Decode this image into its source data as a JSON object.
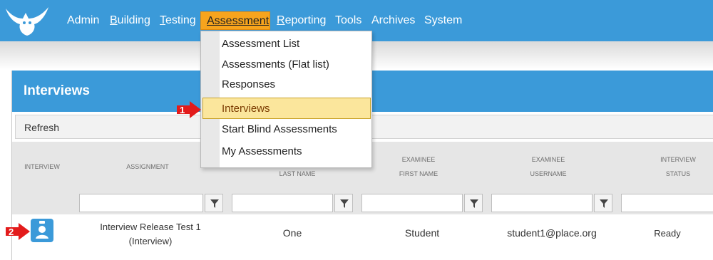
{
  "nav": {
    "admin": "Admin",
    "building_first": "B",
    "building_rest": "uilding",
    "testing_first": "T",
    "testing_rest": "esting",
    "assessment": "Assessment",
    "reporting_first": "R",
    "reporting_rest": "eporting",
    "tools": "Tools",
    "archives": "Archives",
    "system": "System"
  },
  "menu": {
    "items": [
      "Assessment List",
      "Assessments (Flat list)",
      "Responses",
      "Interviews",
      "Start Blind Assessments",
      "My Assessments"
    ],
    "highlighted": "Interviews"
  },
  "panel": {
    "title": "Interviews",
    "refresh": "Refresh"
  },
  "grid": {
    "headers": {
      "interview": "INTERVIEW",
      "assignment": "ASSIGNMENT",
      "last_name": "LAST NAME",
      "examinee1": "EXAMINEE",
      "first_name": "FIRST NAME",
      "examinee2": "EXAMINEE",
      "username": "USERNAME",
      "interview2": "INTERVIEW",
      "status": "STATUS"
    },
    "row": {
      "assignment_line1": "Interview Release Test 1",
      "assignment_line2": "(Interview)",
      "last_name": "One",
      "first_name": "Student",
      "username": "student1@place.org",
      "status": "Ready"
    }
  },
  "callouts": {
    "one": "1",
    "two": "2"
  },
  "colors": {
    "header_blue": "#3b9ad9",
    "active_orange": "#f7a41d",
    "highlight": "#fbe69c",
    "callout_red": "#e31b1b"
  }
}
